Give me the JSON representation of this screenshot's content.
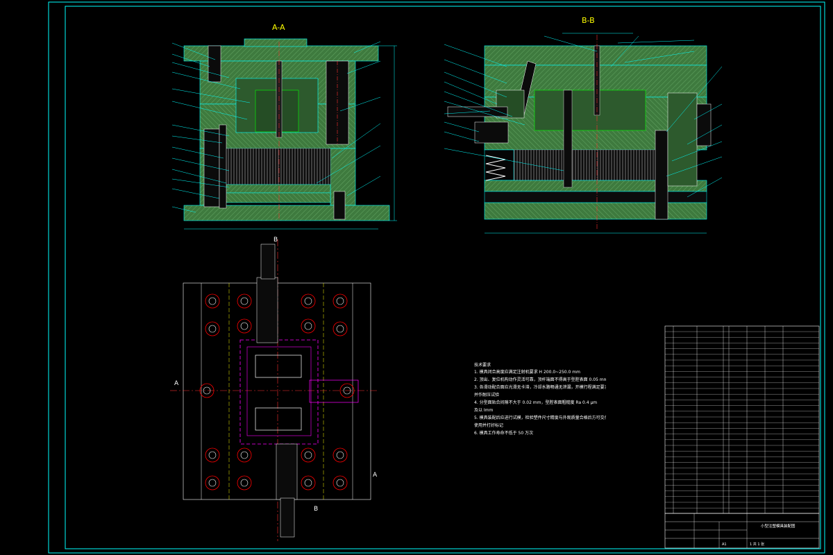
{
  "sections": {
    "aa": {
      "title": "A-A"
    },
    "bb": {
      "title": "B-B"
    }
  },
  "plan_markers": {
    "b": "B",
    "a": "A"
  },
  "notes": {
    "title": "技术要求",
    "lines": [
      "1. 模具闭合高度应满足注射机要求 H 200.0~250.0 mm",
      "2. 顶出、复位机构动作灵活可靠，顶杆端面不得高于型腔表面 0.05 mm",
      "3. 各滑动配合面应光滑无卡滞，冷却水路畅通无泄漏，开模行程满足要求",
      "   并作耐压试验",
      "4. 分型面贴合间隙不大于 0.02 mm，型腔表面粗糙度 Ra 0.4 μm",
      "   及以 Imm",
      "5. 模具装配后应进行试模，检验塑件尺寸精度与外观质量合格后方可交付",
      "   使用并打好标记",
      "6. 模具工作寿命不低于 50 万次"
    ]
  },
  "title_block": {
    "drawing_name": "小型注塑模具装配图",
    "scale_label": "A1",
    "sheet_label": "1 共 1 张"
  },
  "colors": {
    "frame": "#00ffff",
    "hatch": "#3f7f3f",
    "hatch_light": "#5fa05f",
    "part_fill": "#2d5a2d",
    "leader": "#00ffff",
    "section_label": "#ffff00",
    "center_line": "#ff3030",
    "hidden_line": "#ff00ff",
    "bolt_circle": "#ff0000",
    "annotation": "#ffffff"
  }
}
